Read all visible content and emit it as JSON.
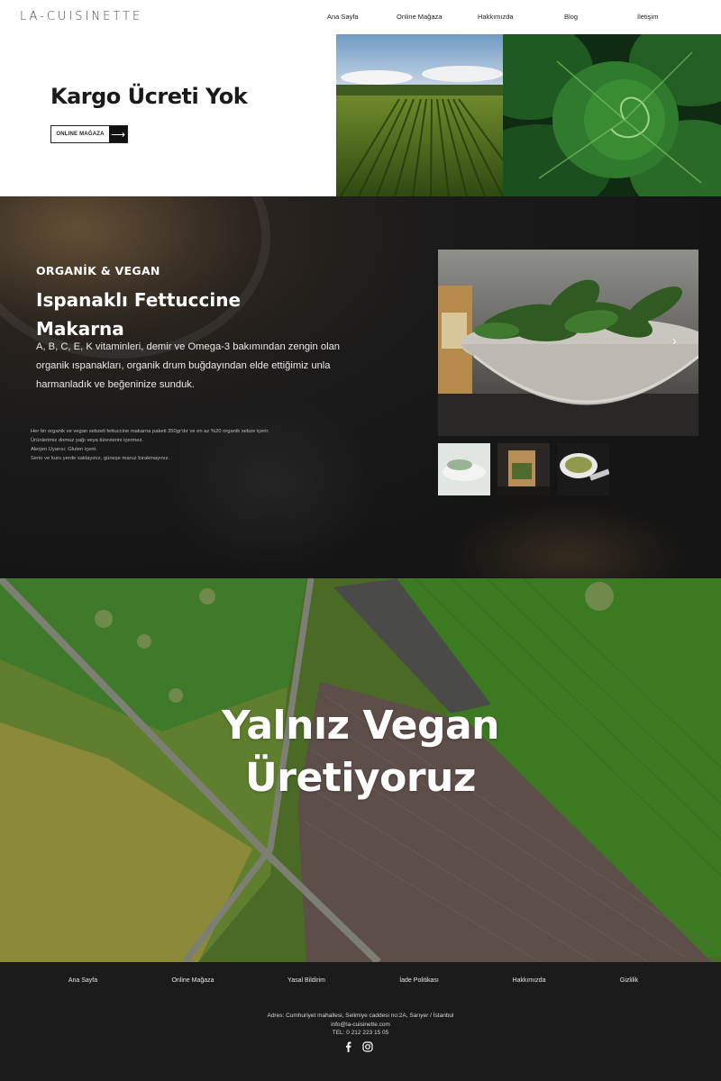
{
  "header": {
    "logo": "LA-CUISINETTE",
    "nav": [
      "Ana Sayfa",
      "Online Mağaza",
      "Hakkımızda",
      "Blog",
      "İletişim"
    ]
  },
  "hero": {
    "title": "Kargo Ücreti Yok",
    "button_label": "ONLINE MAĞAZA",
    "button_icon": "arrow-right-icon"
  },
  "product": {
    "tag": "ORGANİK & VEGAN",
    "title": "Ispanaklı Fettuccine Makarna",
    "description": "A, B, C, E, K vitaminleri, demir ve Omega-3 bakımından zengin olan organik ıspanakları, organik drum buğdayından elde ettiğimiz unla harmanladık ve beğeninize sunduk.",
    "notes": [
      "Her bir organik ve vegan sebzeli fettuccine makarna paketi 350gr'dır ve en az %20 organik sebze içerir.",
      "Ürünlerimiz domuz yağı veya türevlerini içermez.",
      "Alerjen Uyarısı: Gluten içerir.",
      "Serin ve kuru yerde saklayınız, güneşe maruz bırakmayınız."
    ]
  },
  "vegan": {
    "title_line1": "Yalnız Vegan",
    "title_line2": "Üretiyoruz"
  },
  "footer": {
    "nav": [
      "Ana Sayfa",
      "Online Mağaza",
      "Yasal Bildirim",
      "İade Politikası",
      "Hakkımızda",
      "Gizlilik"
    ],
    "address": "Adres: Cumhuriyet mahallesi, Selimiye caddesi no:2A, Sarıyer / İstanbul",
    "email": "info@la-cuisinette.com",
    "phone": "TEL: 0 212 223 15 05",
    "social_icons": [
      "facebook-icon",
      "instagram-icon"
    ]
  },
  "colors": {
    "dark_bg": "#1b1b1b",
    "product_bg": "#151515",
    "accent_green": "#3d5a21"
  }
}
